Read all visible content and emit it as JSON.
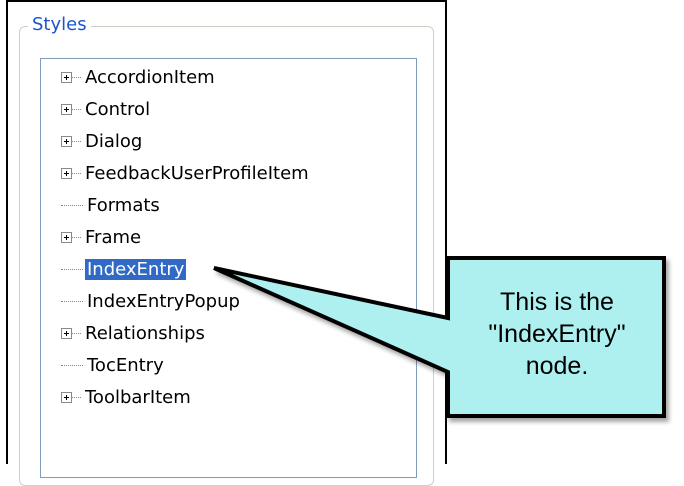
{
  "group_title": "Styles",
  "tree_items": [
    {
      "label": "AccordionItem",
      "expandable": true
    },
    {
      "label": "Control",
      "expandable": true
    },
    {
      "label": "Dialog",
      "expandable": true
    },
    {
      "label": "FeedbackUserProfileItem",
      "expandable": true
    },
    {
      "label": "Formats",
      "expandable": false
    },
    {
      "label": "Frame",
      "expandable": true
    },
    {
      "label": "IndexEntry",
      "expandable": false,
      "selected": true
    },
    {
      "label": "IndexEntryPopup",
      "expandable": false
    },
    {
      "label": "Relationships",
      "expandable": true
    },
    {
      "label": "TocEntry",
      "expandable": false
    },
    {
      "label": "ToolbarItem",
      "expandable": true
    }
  ],
  "callout": {
    "line1": "This is the",
    "line2": "\"IndexEntry\"",
    "line3": "node.",
    "fill": "#aef0f0",
    "stroke": "#000000"
  },
  "selection_color": "#3169c6",
  "title_color": "#1a55c9"
}
